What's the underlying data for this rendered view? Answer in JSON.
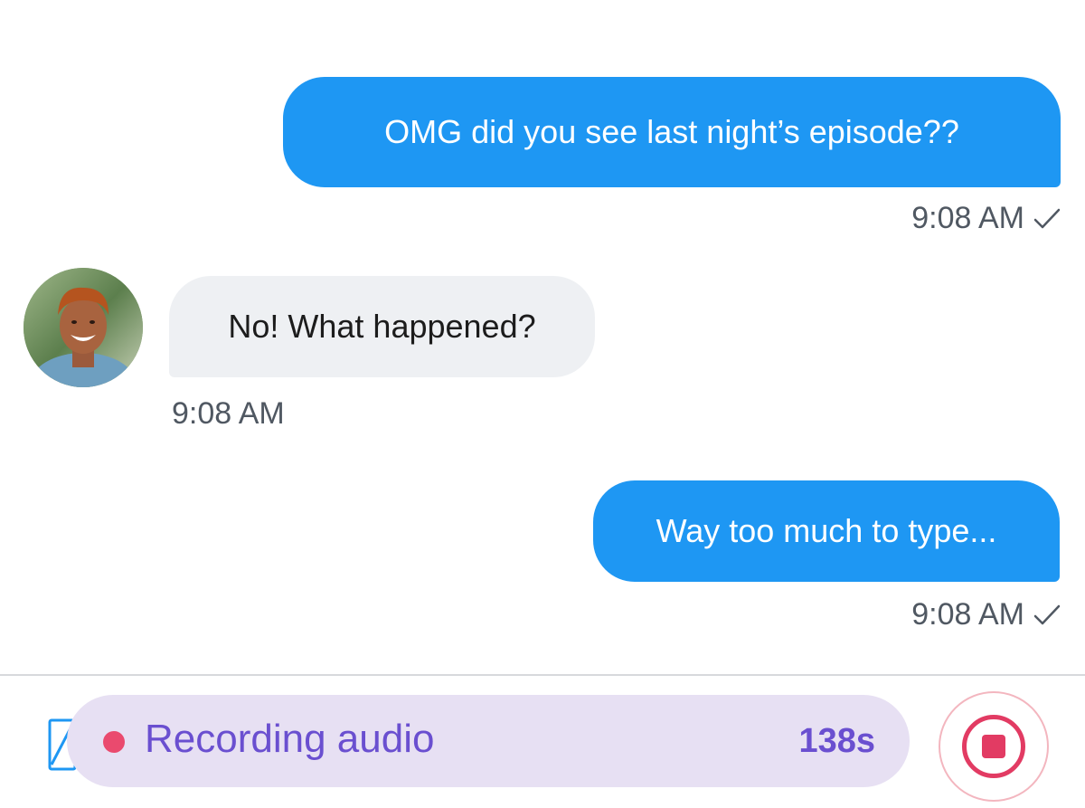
{
  "messages": [
    {
      "direction": "outgoing",
      "text": "OMG did you see last night’s episode??",
      "time": "9:08 AM",
      "status_icon": "check-icon"
    },
    {
      "direction": "incoming",
      "text": "No! What happened?",
      "time": "9:08 AM",
      "avatar": "contact-avatar"
    },
    {
      "direction": "outgoing",
      "text": "Way too much to type...",
      "time": "9:08 AM",
      "status_icon": "check-icon"
    }
  ],
  "composer": {
    "attach_icon": "attachment-icon",
    "recording_label": "Recording audio",
    "recording_timer": "138s",
    "recording_indicator_color": "#ea4a6e",
    "stop_icon": "stop-icon"
  },
  "colors": {
    "outgoing_bubble": "#1e97f3",
    "incoming_bubble": "#eef0f3",
    "recording_pill": "#e7e0f3",
    "recording_text": "#6a4fd0",
    "stop_accent": "#e23b63"
  }
}
